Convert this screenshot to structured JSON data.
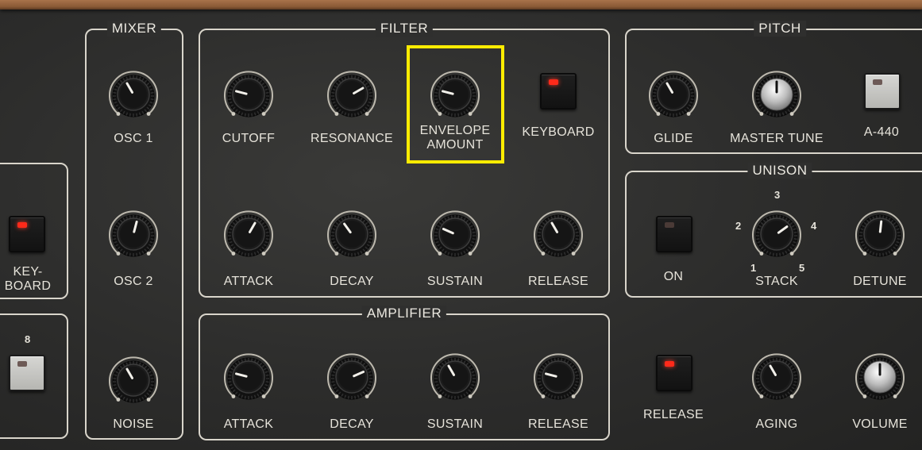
{
  "sections": {
    "mixer": "MIXER",
    "filter": "FILTER",
    "pitch": "PITCH",
    "unison": "UNISON",
    "amplifier": "AMPLIFIER"
  },
  "mixer": {
    "osc1": "OSC 1",
    "osc2": "OSC 2",
    "noise": "NOISE"
  },
  "filter": {
    "cutoff": "CUTOFF",
    "resonance": "RESONANCE",
    "envelope_amount_line1": "ENVELOPE",
    "envelope_amount_line2": "AMOUNT",
    "keyboard": "KEYBOARD",
    "attack": "ATTACK",
    "decay": "DECAY",
    "sustain": "SUSTAIN",
    "release": "RELEASE"
  },
  "pitch": {
    "glide": "GLIDE",
    "master_tune": "MASTER TUNE",
    "a440": "A-440"
  },
  "unison": {
    "on": "ON",
    "stack": "STACK",
    "detune": "DETUNE",
    "stack_marks": [
      "1",
      "2",
      "3",
      "4",
      "5"
    ]
  },
  "amplifier": {
    "attack": "ATTACK",
    "decay": "DECAY",
    "sustain": "SUSTAIN",
    "release": "RELEASE"
  },
  "bottom": {
    "release": "RELEASE",
    "aging": "AGING",
    "volume": "VOLUME"
  },
  "left": {
    "keyboard_line1": "KEY-",
    "keyboard_line2": "BOARD",
    "voice_count": "8"
  },
  "colors": {
    "accent_highlight": "#ffec00",
    "led_on": "#ff2a1a",
    "panel": "#2f2f2e",
    "outline": "#d9d5cb"
  },
  "knob_positions": {
    "osc1": 0.4,
    "osc2": 0.55,
    "noise": 0.4,
    "cutoff": 0.25,
    "resonance": 0.7,
    "envelope_amount": 0.25,
    "filter_attack": 0.6,
    "filter_decay": 0.38,
    "filter_sustain": 0.28,
    "filter_release": 0.4,
    "glide": 0.4,
    "master_tune": 0.5,
    "stack": 0.68,
    "detune": 0.52,
    "amp_attack": 0.25,
    "amp_decay": 0.72,
    "amp_sustain": 0.4,
    "amp_release": 0.25,
    "aging": 0.4,
    "volume": 0.5
  }
}
